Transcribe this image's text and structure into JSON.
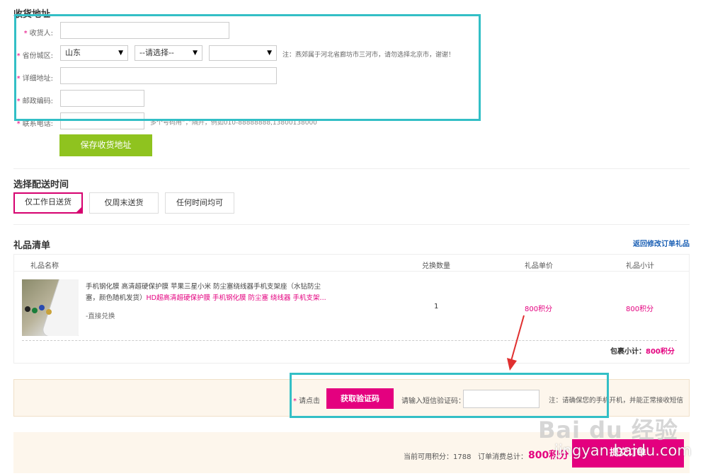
{
  "address": {
    "title": "收货地址",
    "fields": {
      "receiver_label": "收货人:",
      "region_label": "省份城区:",
      "detail_label": "详细地址:",
      "zip_label": "邮政编码:",
      "phone_label": "联系电话:"
    },
    "required_mark": "*",
    "province_value": "山东",
    "city_value": "--请选择--",
    "district_value": "",
    "region_note": "注：燕郊属于河北省廊坊市三河市，请勿选择北京市，谢谢！",
    "phone_hint": "多个号码用“，”隔开，例如010-88888888,13800138000",
    "save_label": "保存收货地址"
  },
  "delivery": {
    "title": "选择配送时间",
    "options": [
      "仅工作日送货",
      "仅周末送货",
      "任何时间均可"
    ],
    "selected_index": 0
  },
  "gift_list": {
    "title": "礼品清单",
    "back_link": "返回修改订单礼品",
    "headers": [
      "礼品名称",
      "兑换数量",
      "礼品单价",
      "礼品小计"
    ],
    "item": {
      "name_line1": "手机钢化膜 高清超硬保护膜 苹果三星小米 防尘塞绕线器手机支架座（水钻防尘",
      "name_line2_black": "塞，颜色随机发货）",
      "name_line2_pink": "HD超高清超硬保护膜 手机钢化膜 防尘塞 绕线器 手机支架...",
      "tag": "-直接兑换",
      "qty": "1",
      "unit_price": "800积分",
      "subtotal": "800积分"
    },
    "package_subtotal_label": "包裹小计：",
    "package_subtotal_value": "800积分"
  },
  "verify": {
    "prompt": "请点击",
    "get_code_label": "获取验证码",
    "input_label": "请输入短信验证码：",
    "code_value": "",
    "note": "注：请确保您的手机开机，并能正常接收短信"
  },
  "footer": {
    "available_label": "当前可用积分：",
    "available_value": "1788",
    "total_label": "订单消费总计：",
    "total_value": "800积分",
    "submit_label": "提交订单"
  },
  "watermark": {
    "logo": "Bai du 经验",
    "url": "jingyan.baidu.com"
  },
  "colors": {
    "accent_pink": "#e4007f",
    "highlight_teal": "#33bfc6",
    "green_button": "#8fc31f",
    "arrow_red": "#e03030"
  }
}
